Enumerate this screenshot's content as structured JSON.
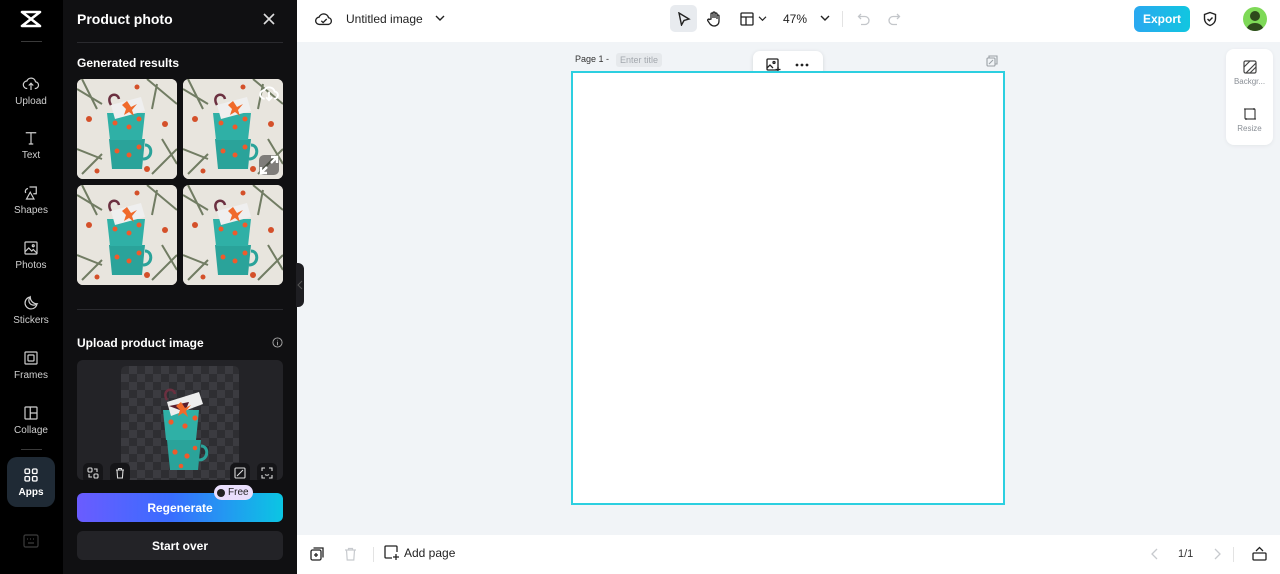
{
  "rail": {
    "items": [
      {
        "label": "Upload",
        "icon": "upload-cloud-icon"
      },
      {
        "label": "Text",
        "icon": "text-icon"
      },
      {
        "label": "Shapes",
        "icon": "shapes-icon"
      },
      {
        "label": "Photos",
        "icon": "photos-icon"
      },
      {
        "label": "Stickers",
        "icon": "stickers-icon"
      },
      {
        "label": "Frames",
        "icon": "frames-icon"
      },
      {
        "label": "Collage",
        "icon": "collage-icon"
      },
      {
        "label": "Apps",
        "icon": "apps-grid-icon",
        "active": true
      }
    ]
  },
  "panel": {
    "title": "Product photo",
    "generated_results_label": "Generated results",
    "results_count": 4,
    "upload_label": "Upload product image",
    "regenerate_label": "Regenerate",
    "free_badge": "Free",
    "start_over_label": "Start over"
  },
  "topbar": {
    "document_name": "Untitled image",
    "zoom": "47%",
    "export_label": "Export"
  },
  "canvas": {
    "page_label": "Page 1 -",
    "title_placeholder": "Enter title"
  },
  "right_panel": {
    "background_label": "Backgr...",
    "resize_label": "Resize"
  },
  "bottombar": {
    "add_page_label": "Add page",
    "page_indicator": "1/1"
  },
  "colors": {
    "accent_cyan": "#2ccfe0",
    "export_gradient_start": "#2aa8f0",
    "regenerate_gradient_start": "#6a5cff",
    "regenerate_gradient_end": "#0bc6e3"
  }
}
